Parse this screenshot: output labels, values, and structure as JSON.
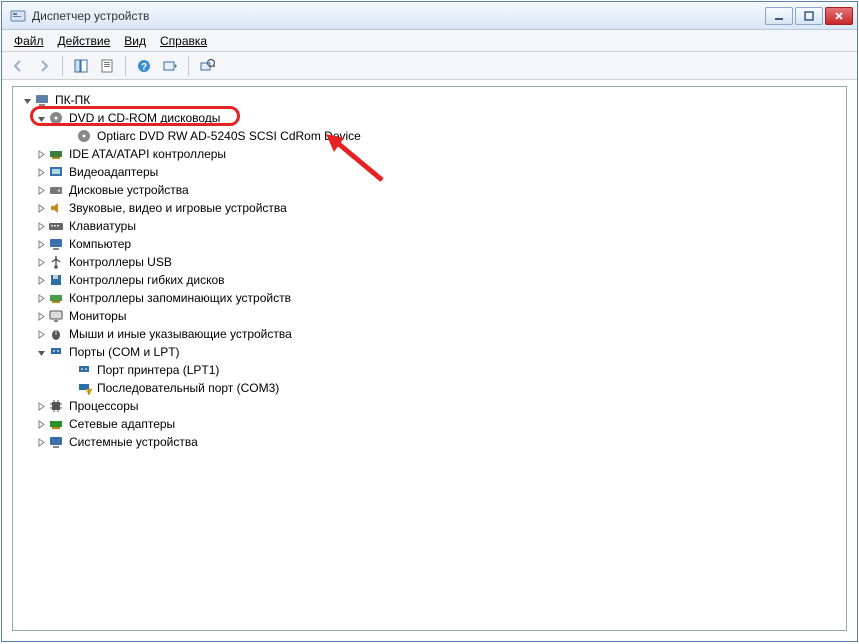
{
  "window": {
    "title": "Диспетчер устройств"
  },
  "menu": {
    "file": "Файл",
    "action": "Действие",
    "view": "Вид",
    "help": "Справка"
  },
  "tree": {
    "root": "ПК-ПК",
    "dvd": {
      "label": "DVD и CD-ROM дисководы",
      "child": "Optiarc DVD RW AD-5240S SCSI CdRom Device"
    },
    "ide": "IDE ATA/ATAPI контроллеры",
    "video": "Видеоадаптеры",
    "diskdrives": "Дисковые устройства",
    "sound": "Звуковые, видео и игровые устройства",
    "keyboards": "Клавиатуры",
    "computer": "Компьютер",
    "usb": "Контроллеры USB",
    "floppy_ctrl": "Контроллеры гибких дисков",
    "storage_ctrl": "Контроллеры запоминающих устройств",
    "monitors": "Мониторы",
    "mice": "Мыши и иные указывающие устройства",
    "ports": {
      "label": "Порты (COM и LPT)",
      "printer_port": "Порт принтера (LPT1)",
      "serial_port": "Последовательный порт (COM3)"
    },
    "cpus": "Процессоры",
    "network": "Сетевые адаптеры",
    "system": "Системные устройства"
  }
}
